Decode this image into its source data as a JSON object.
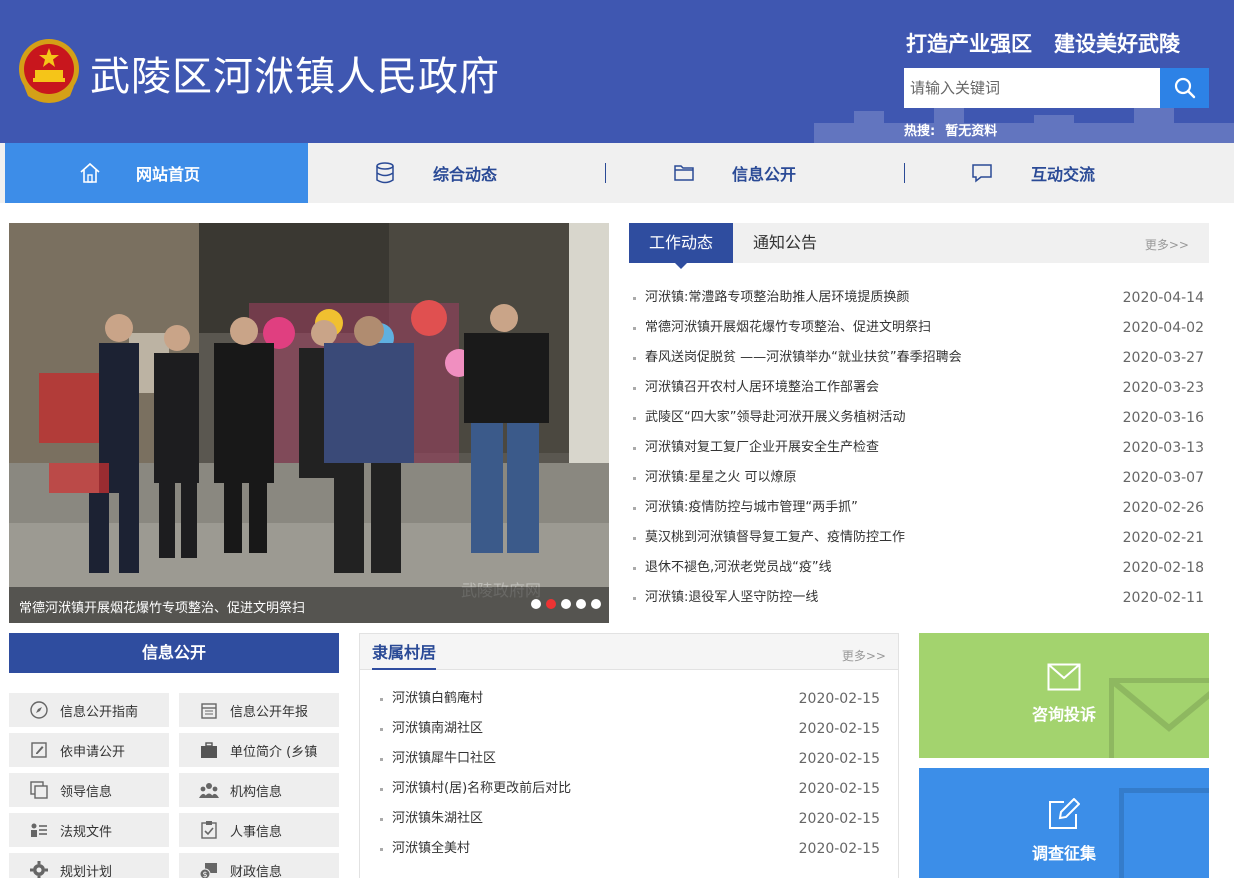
{
  "header": {
    "site_title": "武陵区河洑镇人民政府",
    "slogan_1": "打造产业强区",
    "slogan_2": "建设美好武陵",
    "search_placeholder": "请输入关键词",
    "hot_label": "热搜:",
    "hot_value": "暂无资料"
  },
  "nav": {
    "items": [
      {
        "label": "网站首页",
        "icon": "home-icon"
      },
      {
        "label": "综合动态",
        "icon": "database-icon"
      },
      {
        "label": "信息公开",
        "icon": "folder-icon"
      },
      {
        "label": "互动交流",
        "icon": "chat-icon"
      }
    ]
  },
  "slider": {
    "caption": "常德河洑镇开展烟花爆竹专项整治、促进文明祭扫",
    "watermark": "武陵政府网",
    "dot_count": 5,
    "active_dot": 1
  },
  "news": {
    "tab_active": "工作动态",
    "tab_other": "通知公告",
    "more": "更多>>",
    "items": [
      {
        "title": "河洑镇:常澧路专项整治助推人居环境提质换颜",
        "date": "2020-04-14"
      },
      {
        "title": "常德河洑镇开展烟花爆竹专项整治、促进文明祭扫",
        "date": "2020-04-02"
      },
      {
        "title": "春风送岗促脱贫 ——河洑镇举办“就业扶贫”春季招聘会",
        "date": "2020-03-27"
      },
      {
        "title": "河洑镇召开农村人居环境整治工作部署会",
        "date": "2020-03-23"
      },
      {
        "title": "武陵区“四大家”领导赴河洑开展义务植树活动",
        "date": "2020-03-16"
      },
      {
        "title": "河洑镇对复工复厂企业开展安全生产检查",
        "date": "2020-03-13"
      },
      {
        "title": "河洑镇:星星之火 可以燎原",
        "date": "2020-03-07"
      },
      {
        "title": "河洑镇:疫情防控与城市管理“两手抓”",
        "date": "2020-02-26"
      },
      {
        "title": "莫汉桃到河洑镇督导复工复产、疫情防控工作",
        "date": "2020-02-21"
      },
      {
        "title": "退休不褪色,河洑老党员战“疫”线",
        "date": "2020-02-18"
      },
      {
        "title": "河洑镇:退役军人坚守防控一线",
        "date": "2020-02-11"
      }
    ]
  },
  "info_open": {
    "title": "信息公开",
    "items": [
      {
        "label": "信息公开指南",
        "icon": "compass-icon"
      },
      {
        "label": "信息公开年报",
        "icon": "calendar-icon"
      },
      {
        "label": "依申请公开",
        "icon": "edit-icon"
      },
      {
        "label": "单位简介 (乡镇",
        "icon": "briefcase-icon"
      },
      {
        "label": "领导信息",
        "icon": "copy-icon"
      },
      {
        "label": "机构信息",
        "icon": "people-icon"
      },
      {
        "label": "法规文件",
        "icon": "list-icon"
      },
      {
        "label": "人事信息",
        "icon": "clipboard-check-icon"
      },
      {
        "label": "规划计划",
        "icon": "gear-icon"
      },
      {
        "label": "财政信息",
        "icon": "money-icon"
      }
    ]
  },
  "villages": {
    "title": "隶属村居",
    "more": "更多>>",
    "items": [
      {
        "title": "河洑镇白鹤庵村",
        "date": "2020-02-15"
      },
      {
        "title": "河洑镇南湖社区",
        "date": "2020-02-15"
      },
      {
        "title": "河洑镇犀牛口社区",
        "date": "2020-02-15"
      },
      {
        "title": "河洑镇村(居)名称更改前后对比",
        "date": "2020-02-15"
      },
      {
        "title": "河洑镇朱湖社区",
        "date": "2020-02-15"
      },
      {
        "title": "河洑镇全美村",
        "date": "2020-02-15"
      }
    ]
  },
  "cards": {
    "consult": {
      "label": "咨询投诉",
      "color": "#a3d36e",
      "icon": "mail-icon"
    },
    "survey": {
      "label": "调查征集",
      "color": "#3c8ee8",
      "icon": "edit-icon"
    }
  },
  "colors": {
    "header_bg": "#3f57b1",
    "nav_active": "#3d8de8",
    "tab_active": "#2f4d9f",
    "nav_text": "#2a4a96"
  }
}
